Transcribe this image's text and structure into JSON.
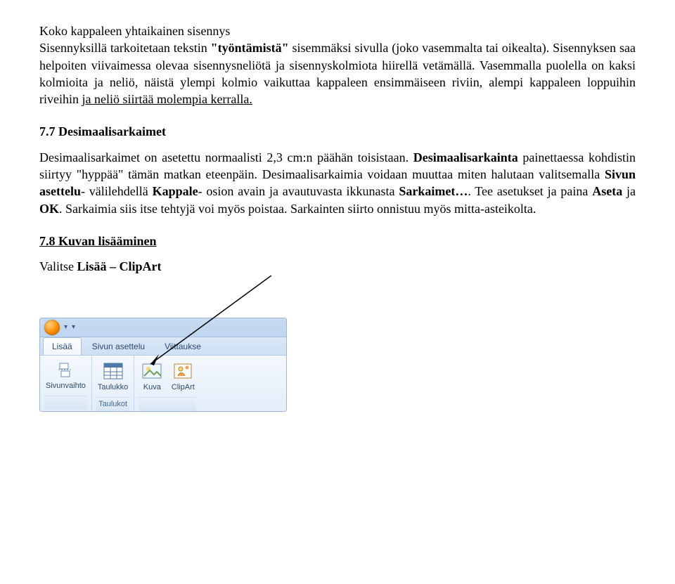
{
  "para1": {
    "line1": "Koko kappaleen yhtaikainen sisennys",
    "line2a": "Sisennyksillä tarkoitetaan tekstin ",
    "bold_quote": "\"työntämistä\"",
    "line2b": " sisemmäksi sivulla (joko vasemmalta tai oikealta). Sisennyksen saa helpoiten viivaimessa olevaa sisennysneliötä ja sisennyskolmiota hiirellä vetämällä. Vasemmalla puolella on kaksi kolmioita ja neliö, näistä ylempi kolmio vaikuttaa kappaleen ensimmäiseen riviin, alempi kappaleen loppuihin riveihin ",
    "under1": "ja neliö siirtää molempia kerralla."
  },
  "heading1": "7.7 Desimaalisarkaimet",
  "para2": {
    "a": "Desimaalisarkaimet on asetettu normaalisti 2,3 cm:n päähän toisistaan. ",
    "bold1": "Desimaalisarkainta",
    "b": " painettaessa kohdistin siirtyy \"hyppää\" tämän matkan eteenpäin. Desimaalisarkaimia voidaan muuttaa miten halutaan valitsemalla ",
    "bold2": "Sivun asettelu",
    "c": "- välilehdellä ",
    "bold3": "Kappale",
    "d": "- osion avain ja avautuvasta ikkunasta ",
    "bold4": "Sarkaimet…",
    "e": ". Tee asetukset ja paina ",
    "bold5": "Aseta",
    "f": " ja ",
    "bold6": "OK",
    "g": ". Sarkaimia siis itse tehtyjä voi myös poistaa. Sarkainten siirto onnistuu myös mitta-asteikolta."
  },
  "heading2": "7.8 Kuvan lisääminen",
  "para3": {
    "a": "Valitse ",
    "bold1": "Lisää – ClipArt"
  },
  "ribbon": {
    "tabs": {
      "t1": "Lisää",
      "t2": "Sivun asettelu",
      "t3": "Viittaukse"
    },
    "buttons": {
      "sivunvaihto": "Sivunvaihto",
      "taulukko": "Taulukko",
      "kuva": "Kuva",
      "clipart": "ClipArt"
    },
    "groups": {
      "taulukot": "Taulukot"
    }
  }
}
